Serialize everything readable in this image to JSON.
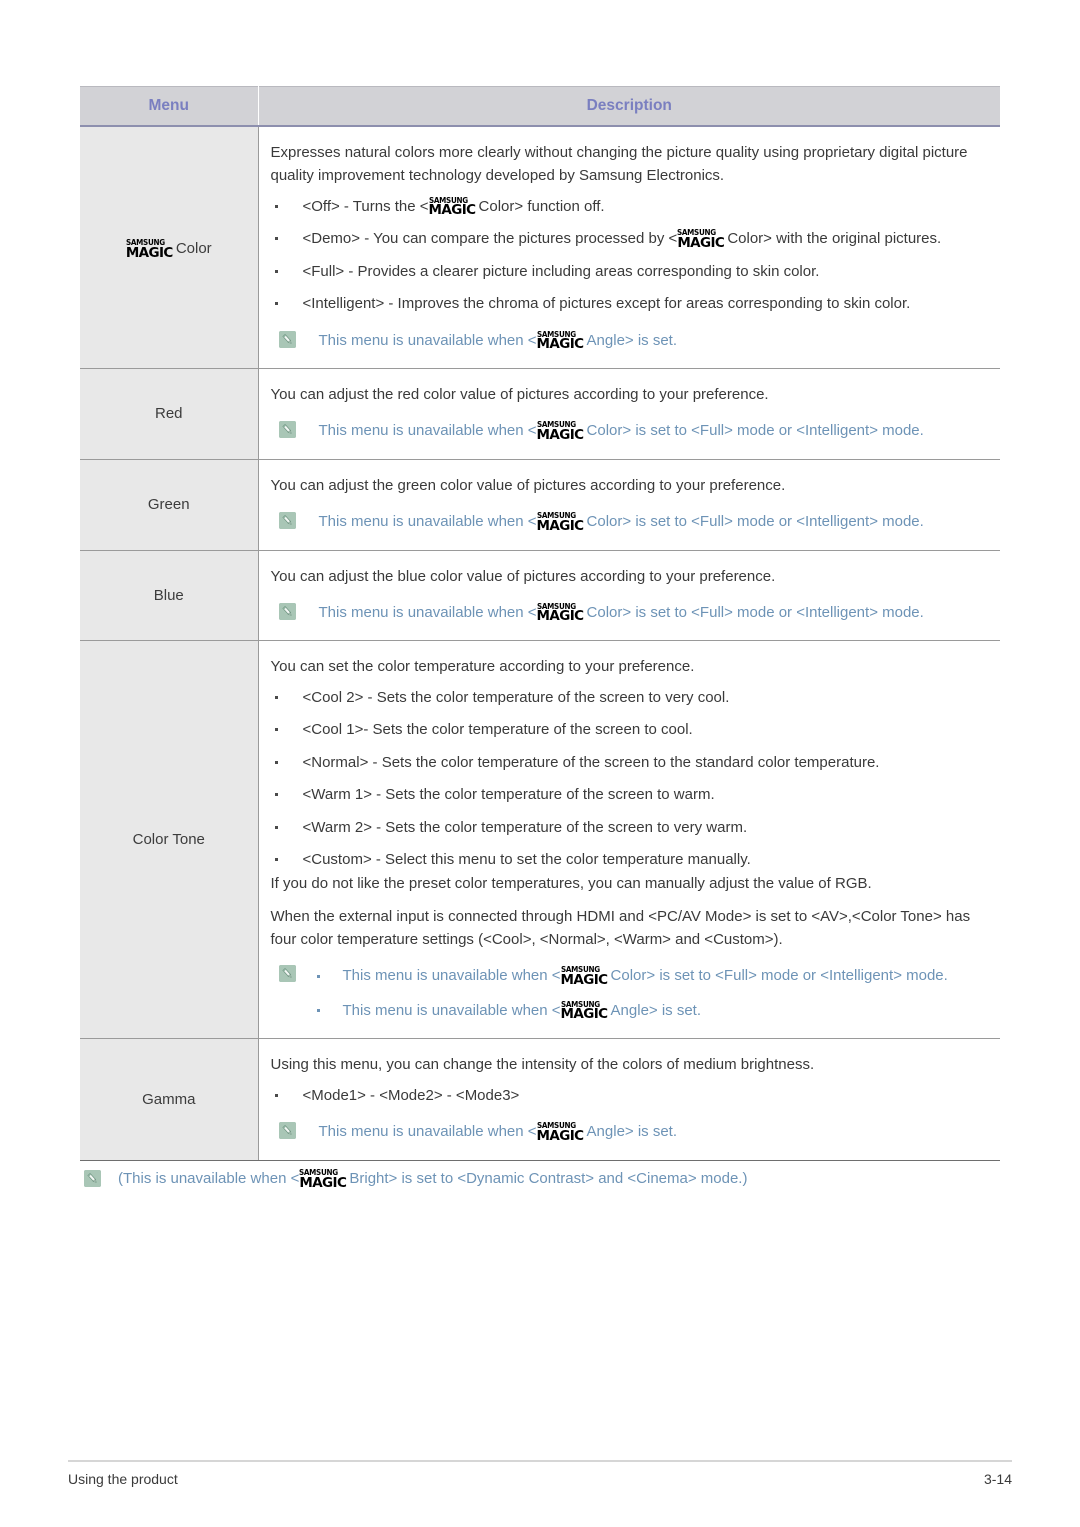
{
  "document": {
    "footer_left": "Using the product",
    "footer_page": "3-14"
  },
  "colors": {
    "header_text": "#7a7fc0",
    "header_bg": "#d2d2d6",
    "menu_cell_bg": "#e8e8e8",
    "note_text": "#6d93b6",
    "note_icon_bg": "#a9c6b6",
    "body_text": "#3a3a3a"
  },
  "table": {
    "headers": {
      "menu": "Menu",
      "description": "Description"
    },
    "rows": [
      {
        "menu_prefix": "",
        "menu_magic": true,
        "menu_label": "Color",
        "paragraphs": [
          "Expresses natural colors more clearly without changing the picture quality using proprietary digital picture quality improvement technology developed by Samsung Electronics."
        ],
        "bullets": [
          {
            "pre": "<Off> - Turns the <",
            "magic": true,
            "post": "Color> function off."
          },
          {
            "pre": "<Demo> - You can compare the pictures processed by <",
            "magic": true,
            "post": "Color> with the original pictures."
          },
          {
            "pre": "<Full> - Provides a clearer picture including areas corresponding to skin color.",
            "magic": false,
            "post": ""
          },
          {
            "pre": "<Intelligent> - Improves the chroma of pictures except for areas corresponding to skin color.",
            "magic": false,
            "post": ""
          }
        ],
        "notes": [
          {
            "pre": "This menu is unavailable when <",
            "magic": true,
            "post": "Angle> is set."
          }
        ]
      },
      {
        "menu_label": "Red",
        "menu_magic": false,
        "paragraphs": [
          "You can adjust the red color value of pictures according to your preference."
        ],
        "bullets": [],
        "notes": [
          {
            "pre": "This menu is unavailable when <",
            "magic": true,
            "post": "Color> is set to <Full> mode or <Intelligent> mode."
          }
        ]
      },
      {
        "menu_label": "Green",
        "menu_magic": false,
        "paragraphs": [
          "You can adjust the green color value of pictures according to your preference."
        ],
        "bullets": [],
        "notes": [
          {
            "pre": "This menu is unavailable when <",
            "magic": true,
            "post": "Color> is set to <Full> mode or <Intelligent> mode."
          }
        ]
      },
      {
        "menu_label": "Blue",
        "menu_magic": false,
        "paragraphs": [
          "You can adjust the blue color value of pictures according to your preference."
        ],
        "bullets": [],
        "notes": [
          {
            "pre": "This menu is unavailable when <",
            "magic": true,
            "post": "Color> is set to <Full> mode or <Intelligent> mode."
          }
        ]
      },
      {
        "menu_label": "Color Tone",
        "menu_magic": false,
        "paragraphs": [
          "You can set the color temperature according to your preference."
        ],
        "bullets": [
          {
            "pre": "<Cool 2> - Sets the color temperature of the screen to very cool.",
            "magic": false,
            "post": ""
          },
          {
            "pre": "<Cool 1>- Sets the color temperature of the screen to cool.",
            "magic": false,
            "post": ""
          },
          {
            "pre": "<Normal> - Sets the color temperature of the screen to the standard color temperature.",
            "magic": false,
            "post": ""
          },
          {
            "pre": "<Warm 1> - Sets the color temperature of the screen to warm.",
            "magic": false,
            "post": ""
          },
          {
            "pre": "<Warm 2> - Sets the color temperature of the screen to very warm.",
            "magic": false,
            "post": ""
          },
          {
            "pre": "<Custom> - Select this menu to set the color temperature manually.",
            "magic": false,
            "post": ""
          }
        ],
        "paragraphs_after": [
          "If you do not like the preset color temperatures, you can manually adjust the value of RGB.",
          "When the external input is connected through HDMI and <PC/AV Mode> is set to <AV>,<Color Tone> has four color temperature settings (<Cool>, <Normal>, <Warm> and <Custom>)."
        ],
        "notes_as_list": true,
        "notes": [
          {
            "pre": "This menu is unavailable when <",
            "magic": true,
            "post": "Color> is set to <Full> mode or <Intelligent> mode."
          },
          {
            "pre": "This menu is unavailable when <",
            "magic": true,
            "post": "Angle> is set."
          }
        ]
      },
      {
        "menu_label": "Gamma",
        "menu_magic": false,
        "paragraphs": [
          "Using this menu, you can change the intensity of the colors of medium brightness."
        ],
        "bullets": [
          {
            "pre": "<Mode1> - <Mode2> - <Mode3>",
            "magic": false,
            "post": ""
          }
        ],
        "notes": [
          {
            "pre": "This menu is unavailable when <",
            "magic": true,
            "post": "Angle> is set."
          }
        ]
      }
    ]
  },
  "magic_logo": {
    "top": "SAMSUNG",
    "bottom": "MAGIC"
  },
  "footnote": {
    "pre": "(This is unavailable when <",
    "magic": true,
    "post": "Bright> is set to <Dynamic Contrast> and <Cinema> mode.)"
  }
}
